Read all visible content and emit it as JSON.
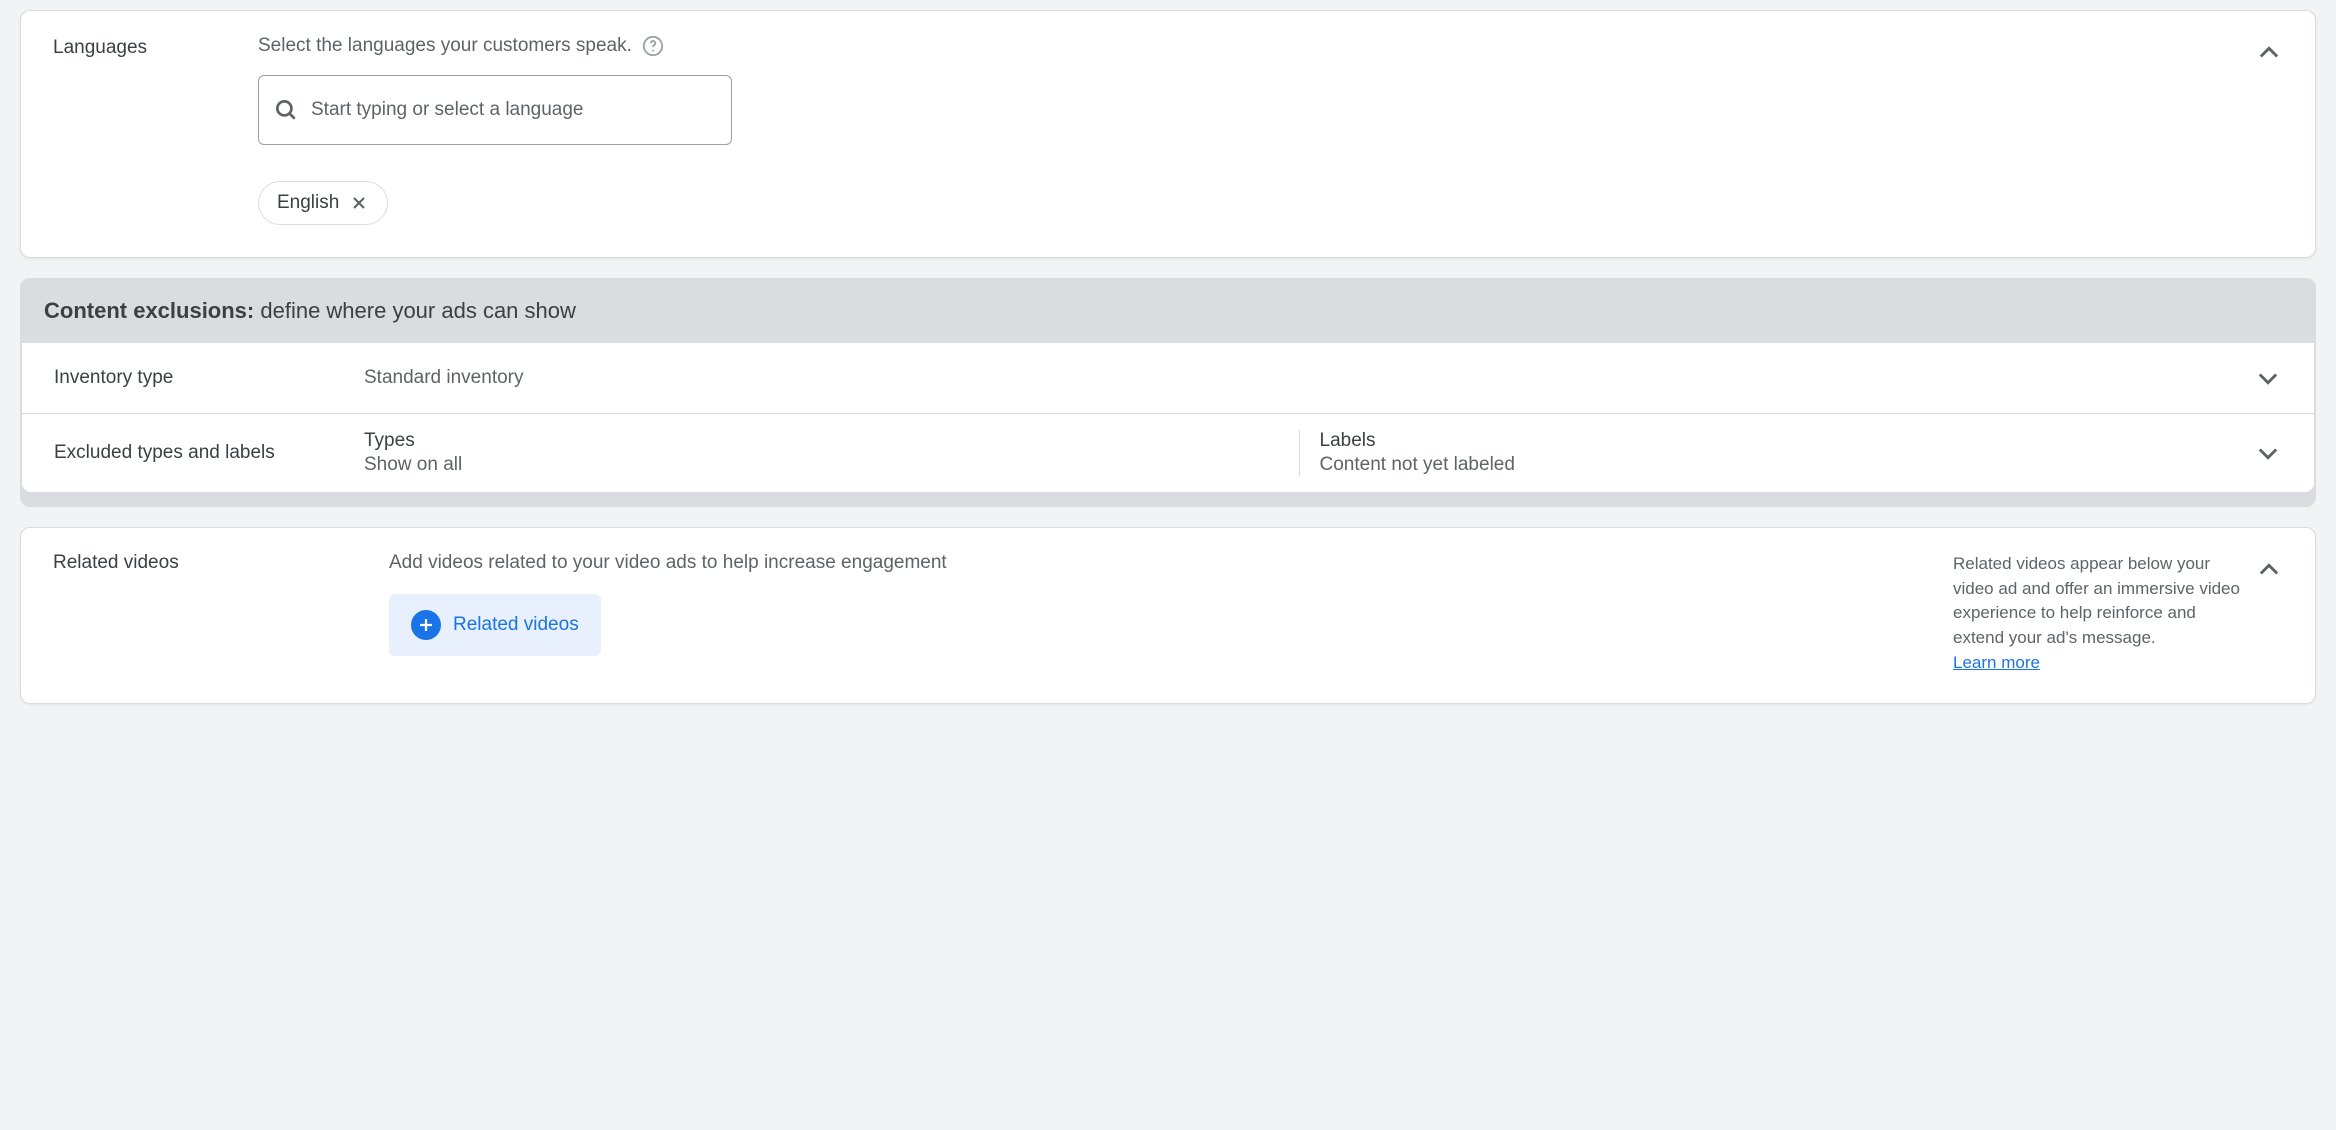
{
  "languages": {
    "label": "Languages",
    "helper": "Select the languages your customers speak.",
    "placeholder": "Start typing or select a language",
    "chips": [
      "English"
    ]
  },
  "exclusions": {
    "title_bold": "Content exclusions:",
    "title_rest": " define where your ads can show",
    "inventory": {
      "label": "Inventory type",
      "value": "Standard inventory"
    },
    "excluded": {
      "label": "Excluded types and labels",
      "types_title": "Types",
      "types_value": "Show on all",
      "labels_title": "Labels",
      "labels_value": "Content not yet labeled"
    }
  },
  "related": {
    "label": "Related videos",
    "description": "Add videos related to your video ads to help increase engagement",
    "button": "Related videos",
    "info": "Related videos appear below your video ad and offer an immersive video experience to help reinforce and extend your ad's message.",
    "learn_more": "Learn more"
  }
}
